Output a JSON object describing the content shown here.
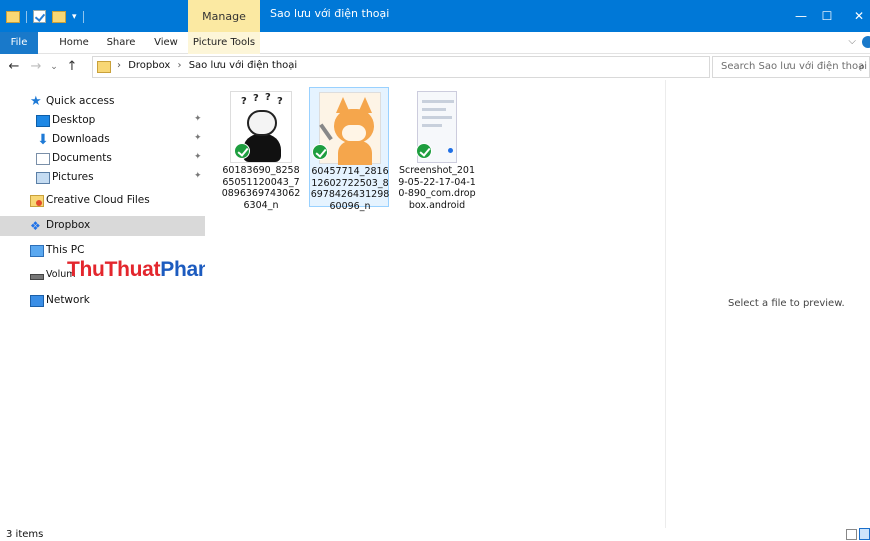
{
  "titlebar": {
    "contextual_tab": "Manage",
    "window_title": "Sao lưu với điện thoại",
    "minimize": "—",
    "maximize": "☐",
    "close": "✕"
  },
  "ribbon": {
    "tabs": [
      "File",
      "Home",
      "Share",
      "View"
    ],
    "contextual_tab": "Picture Tools"
  },
  "address": {
    "crumbs": [
      "Dropbox",
      "Sao lưu với điện thoại"
    ],
    "search_placeholder": "Search Sao lưu với điện thoại"
  },
  "navpane": {
    "quick_access": "Quick access",
    "pinned": [
      "Desktop",
      "Downloads",
      "Documents",
      "Pictures"
    ],
    "items": [
      "Creative Cloud Files",
      "Dropbox",
      "This PC",
      "Volum",
      "Network"
    ]
  },
  "watermark": {
    "part1": "ThuThuat",
    "part2": "PhanMem.vn"
  },
  "files": [
    {
      "name": "60183690_825865051120043_708963697430626304_n",
      "icon": "meme-thumbnail"
    },
    {
      "name": "60457714_281612602722503_8697842643129860096_n",
      "icon": "fox-thumbnail"
    },
    {
      "name": "Screenshot_2019-05-22-17-04-10-890_com.dropbox.android",
      "icon": "screenshot-thumbnail"
    }
  ],
  "preview": {
    "message": "Select a file to preview."
  },
  "status": {
    "item_count": "3 items"
  },
  "colors": {
    "titlebar": "#0078d7",
    "manage_tab": "#fbe9a2",
    "selection": "#d9d9d9",
    "sync_badge": "#1e9e3f",
    "watermark_red": "#e3262d",
    "watermark_blue": "#1c5bbf"
  }
}
